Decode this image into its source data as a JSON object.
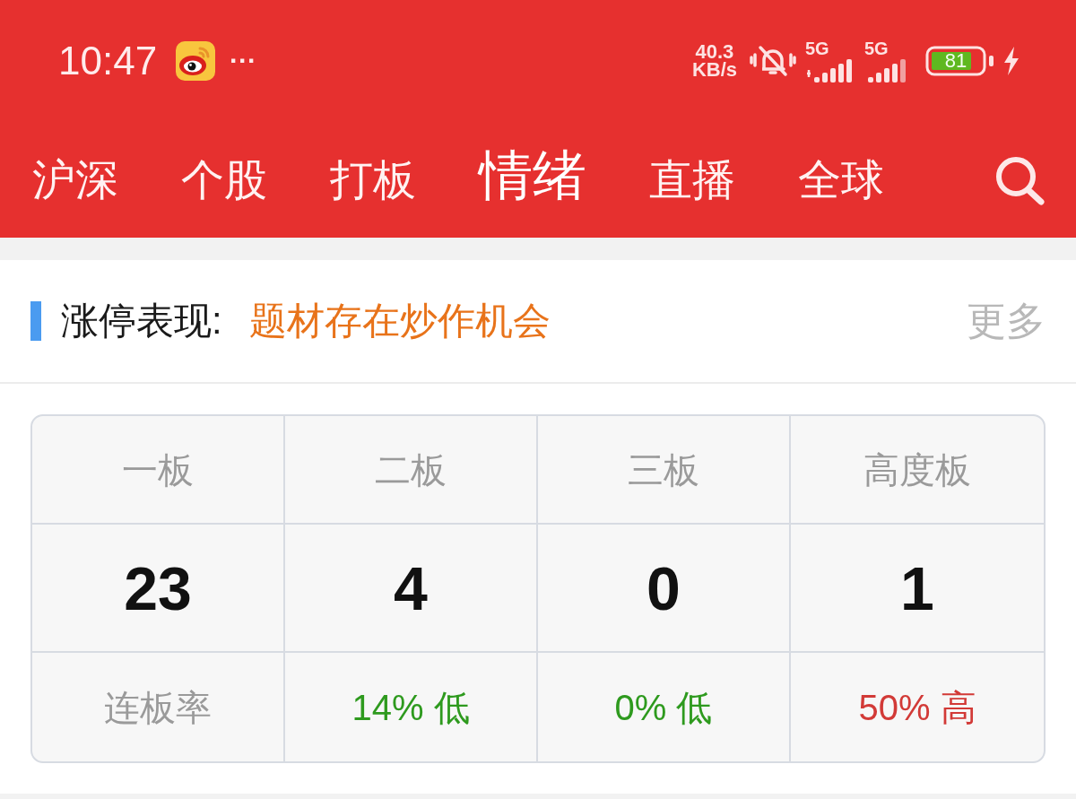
{
  "status_bar": {
    "time": "10:47",
    "more_notifications": "···",
    "network_speed": [
      "40.3",
      "KB/s"
    ],
    "signals": [
      {
        "label": "5G",
        "kind": "data"
      },
      {
        "label": "5G",
        "kind": "standby"
      }
    ],
    "battery": "81"
  },
  "tabs": [
    {
      "label": "沪深",
      "selected": false
    },
    {
      "label": "个股",
      "selected": false
    },
    {
      "label": "打板",
      "selected": false
    },
    {
      "label": "情绪",
      "selected": true
    },
    {
      "label": "直播",
      "selected": false
    },
    {
      "label": "全球",
      "selected": false
    }
  ],
  "section": {
    "title": "涨停表现:",
    "subtitle": "题材存在炒作机会",
    "more": "更多"
  },
  "table": {
    "columns": [
      "一板",
      "二板",
      "三板",
      "高度板"
    ],
    "counts": [
      "23",
      "4",
      "0",
      "1"
    ],
    "rate_label": "连板率",
    "rates": [
      {
        "text": "14% 低",
        "color": "#2e9a1e"
      },
      {
        "text": "0% 低",
        "color": "#2e9a1e"
      },
      {
        "text": "50% 高",
        "color": "#d23a37"
      }
    ]
  }
}
